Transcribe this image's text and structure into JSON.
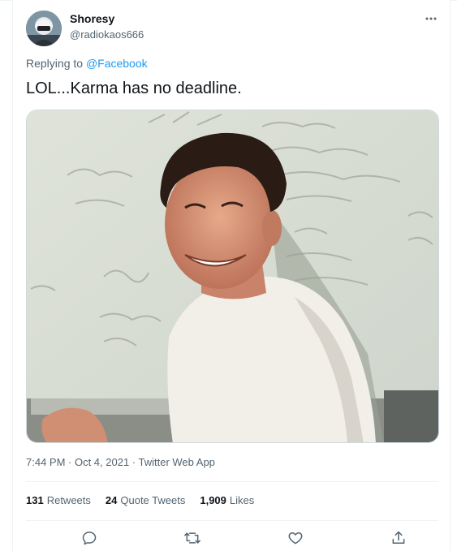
{
  "tweet": {
    "display_name": "Shoresy",
    "handle": "@radiokaos666",
    "more_icon": "more-horizontal-icon",
    "replying_prefix": "Replying to",
    "replying_to": "@Facebook",
    "text": "LOL...Karma has no deadline.",
    "timestamp": "7:44 PM · Oct 4, 2021 · Twitter Web App"
  },
  "stats": {
    "retweets_count": "131",
    "retweets_label": "Retweets",
    "quote_count": "24",
    "quote_label": "Quote Tweets",
    "likes_count": "1,909",
    "likes_label": "Likes"
  },
  "actions": {
    "reply_icon": "reply-icon",
    "retweet_icon": "retweet-icon",
    "like_icon": "heart-icon",
    "share_icon": "share-icon"
  },
  "colors": {
    "accent": "#1d9bf0",
    "secondary_text": "#536471",
    "primary_text": "#0f1419",
    "border": "#eff3f4"
  }
}
